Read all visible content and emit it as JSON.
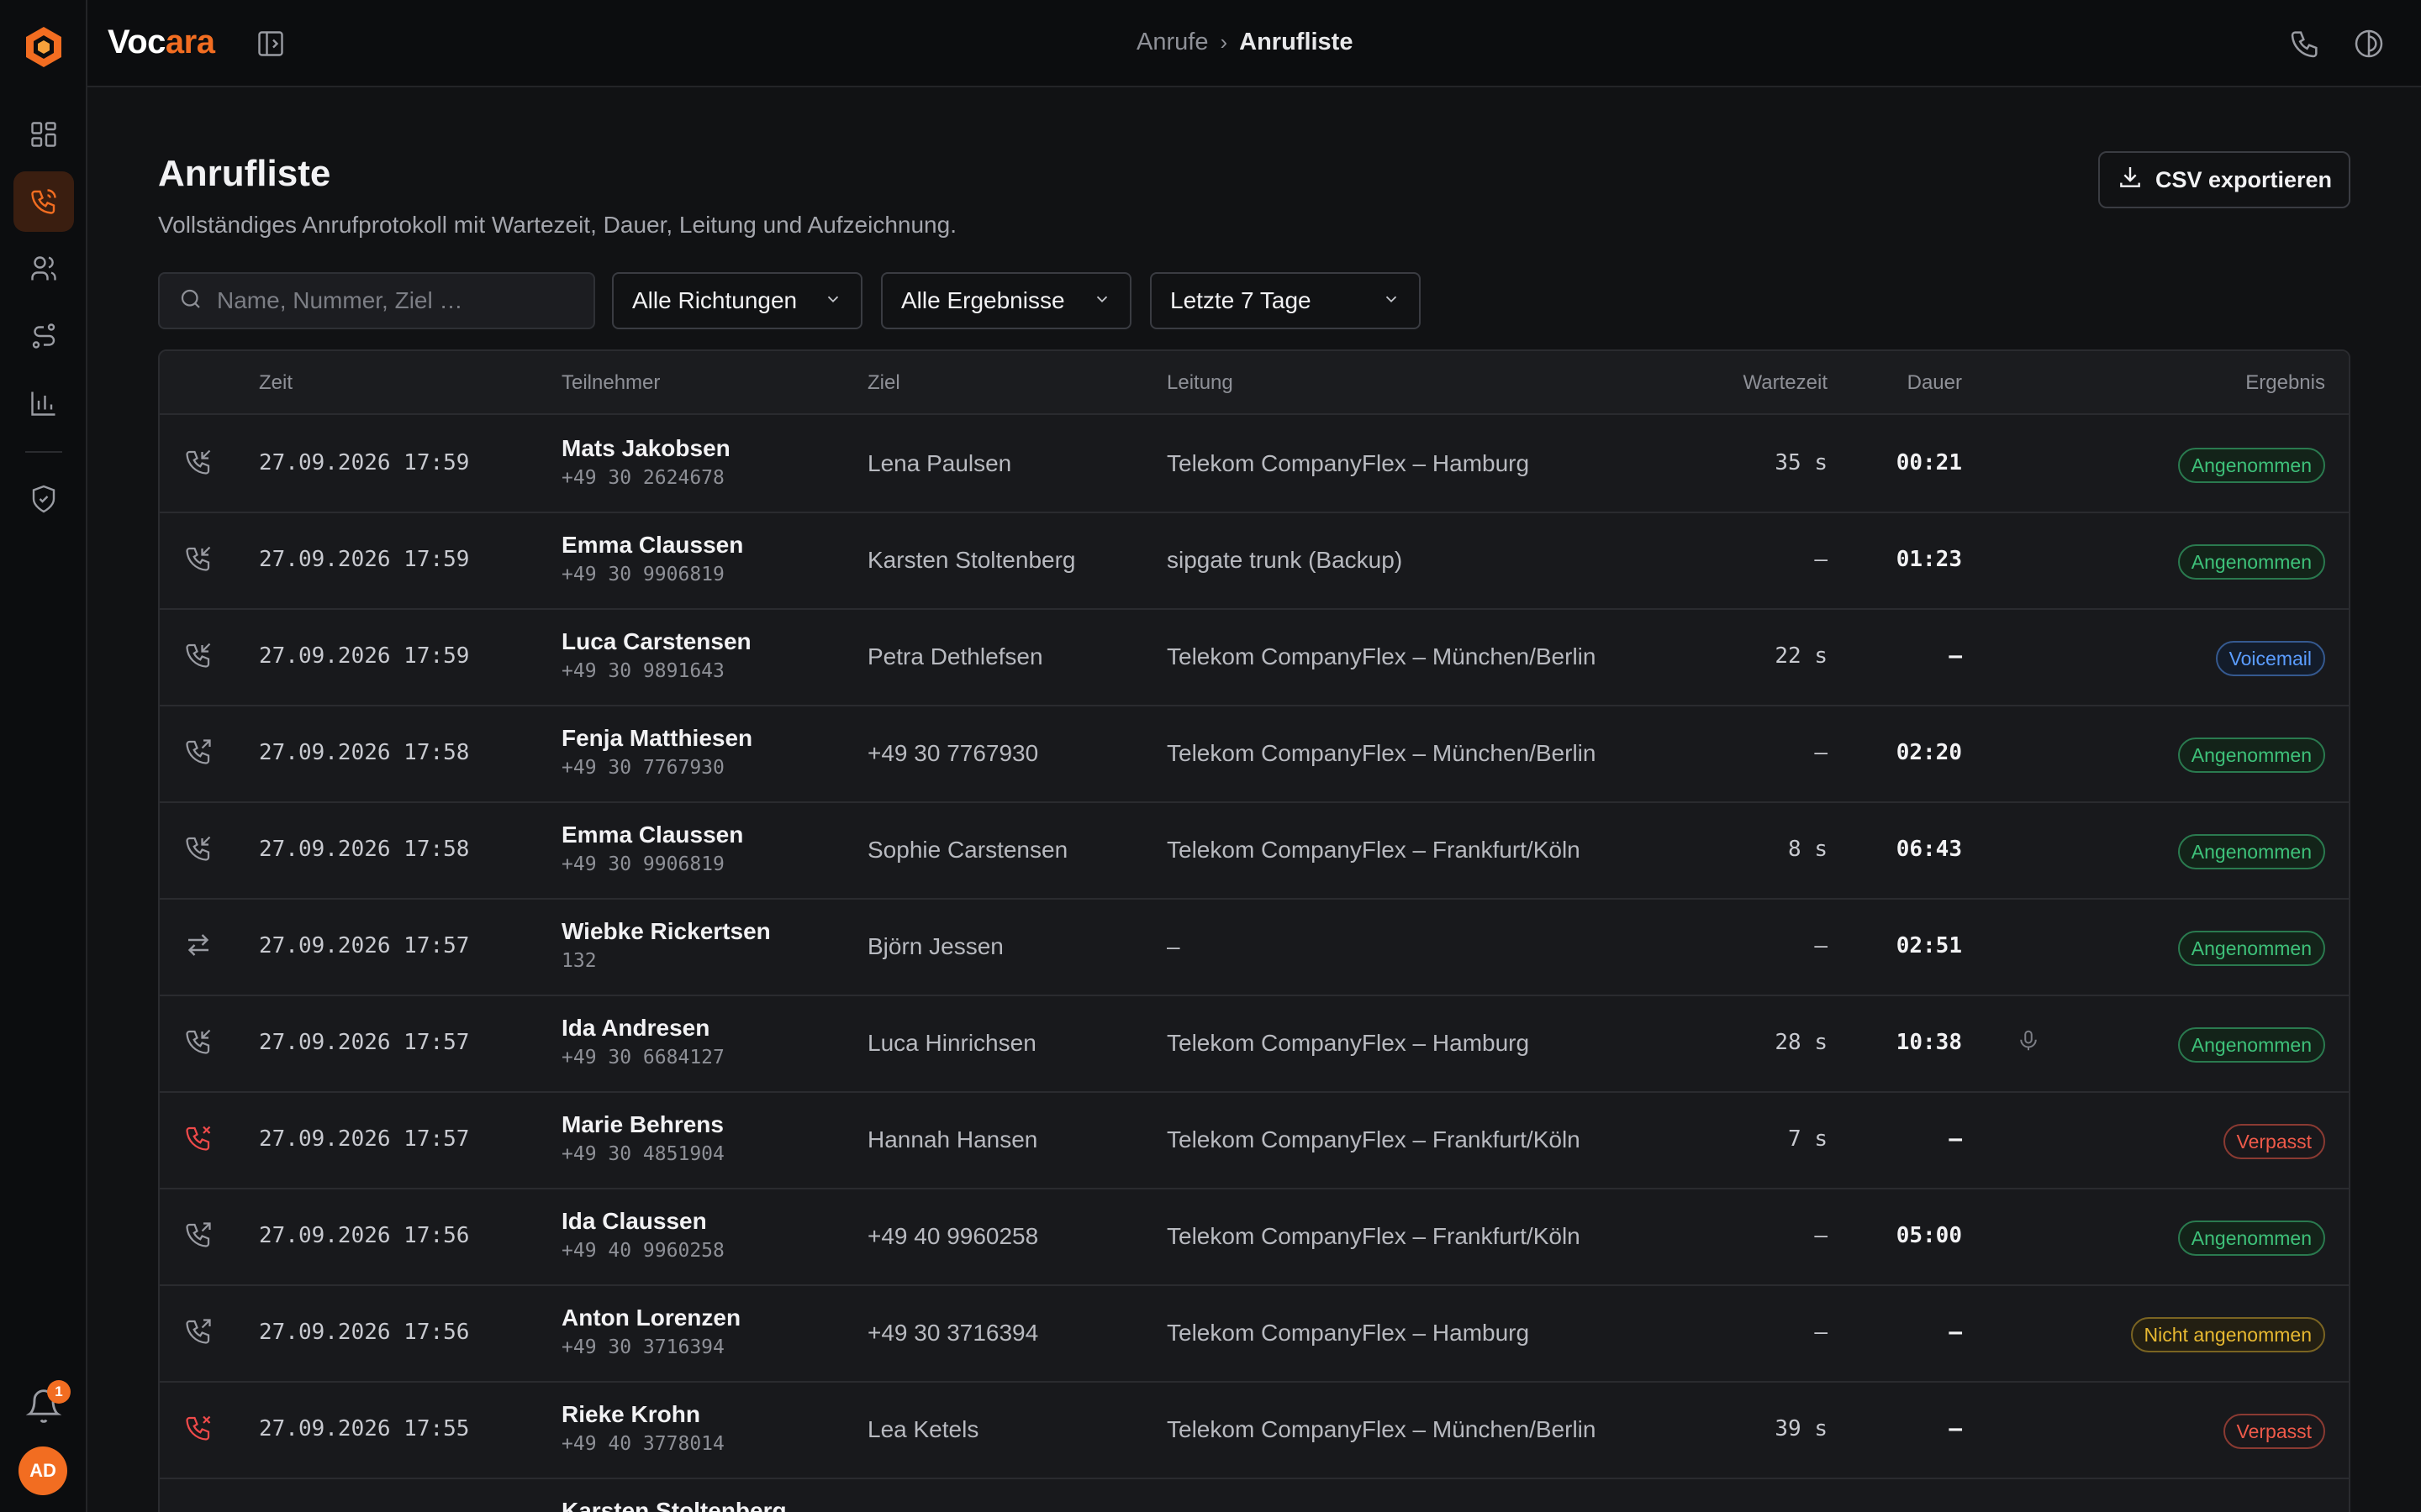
{
  "app": {
    "brand_main": "Voc",
    "brand_accent": "ara"
  },
  "breadcrumb": {
    "parent": "Anrufe",
    "current": "Anrufliste"
  },
  "page": {
    "title": "Anrufliste",
    "subtitle": "Vollständiges Anrufprotokoll mit Wartezeit, Dauer, Leitung und Aufzeichnung.",
    "export_label": "CSV exportieren"
  },
  "filters": {
    "search_placeholder": "Name, Nummer, Ziel …",
    "direction": "Alle Richtungen",
    "result": "Alle Ergebnisse",
    "period": "Letzte 7 Tage"
  },
  "table": {
    "headers": {
      "time": "Zeit",
      "participant": "Teilnehmer",
      "target": "Ziel",
      "line": "Leitung",
      "wait": "Wartezeit",
      "duration": "Dauer",
      "result": "Ergebnis"
    },
    "rows": [
      {
        "dir": "incoming",
        "time": "27.09.2026 17:59",
        "name": "Mats Jakobsen",
        "number": "+49 30 2624678",
        "target": "Lena Paulsen",
        "line": "Telekom CompanyFlex – Hamburg",
        "wait": "35 s",
        "duration": "00:21",
        "recording": false,
        "result": "Angenommen",
        "status": "ok"
      },
      {
        "dir": "incoming",
        "time": "27.09.2026 17:59",
        "name": "Emma Claussen",
        "number": "+49 30 9906819",
        "target": "Karsten Stoltenberg",
        "line": "sipgate trunk (Backup)",
        "wait": "–",
        "duration": "01:23",
        "recording": false,
        "result": "Angenommen",
        "status": "ok"
      },
      {
        "dir": "incoming",
        "time": "27.09.2026 17:59",
        "name": "Luca Carstensen",
        "number": "+49 30 9891643",
        "target": "Petra Dethlefsen",
        "line": "Telekom CompanyFlex – München/Berlin",
        "wait": "22 s",
        "duration": "–",
        "recording": false,
        "result": "Voicemail",
        "status": "vm"
      },
      {
        "dir": "outgoing",
        "time": "27.09.2026 17:58",
        "name": "Fenja Matthiesen",
        "number": "+49 30 7767930",
        "target": "+49 30 7767930",
        "line": "Telekom CompanyFlex – München/Berlin",
        "wait": "–",
        "duration": "02:20",
        "recording": false,
        "result": "Angenommen",
        "status": "ok"
      },
      {
        "dir": "incoming",
        "time": "27.09.2026 17:58",
        "name": "Emma Claussen",
        "number": "+49 30 9906819",
        "target": "Sophie Carstensen",
        "line": "Telekom CompanyFlex – Frankfurt/Köln",
        "wait": "8 s",
        "duration": "06:43",
        "recording": false,
        "result": "Angenommen",
        "status": "ok"
      },
      {
        "dir": "internal",
        "time": "27.09.2026 17:57",
        "name": "Wiebke Rickertsen",
        "number": "132",
        "target": "Björn Jessen",
        "line": "–",
        "wait": "–",
        "duration": "02:51",
        "recording": false,
        "result": "Angenommen",
        "status": "ok"
      },
      {
        "dir": "incoming",
        "time": "27.09.2026 17:57",
        "name": "Ida Andresen",
        "number": "+49 30 6684127",
        "target": "Luca Hinrichsen",
        "line": "Telekom CompanyFlex – Hamburg",
        "wait": "28 s",
        "duration": "10:38",
        "recording": true,
        "result": "Angenommen",
        "status": "ok"
      },
      {
        "dir": "missed",
        "time": "27.09.2026 17:57",
        "name": "Marie Behrens",
        "number": "+49 30 4851904",
        "target": "Hannah Hansen",
        "line": "Telekom CompanyFlex – Frankfurt/Köln",
        "wait": "7 s",
        "duration": "–",
        "recording": false,
        "result": "Verpasst",
        "status": "miss"
      },
      {
        "dir": "outgoing",
        "time": "27.09.2026 17:56",
        "name": "Ida Claussen",
        "number": "+49 40 9960258",
        "target": "+49 40 9960258",
        "line": "Telekom CompanyFlex – Frankfurt/Köln",
        "wait": "–",
        "duration": "05:00",
        "recording": false,
        "result": "Angenommen",
        "status": "ok"
      },
      {
        "dir": "outgoing",
        "time": "27.09.2026 17:56",
        "name": "Anton Lorenzen",
        "number": "+49 30 3716394",
        "target": "+49 30 3716394",
        "line": "Telekom CompanyFlex – Hamburg",
        "wait": "–",
        "duration": "–",
        "recording": false,
        "result": "Nicht angenommen",
        "status": "na"
      },
      {
        "dir": "missed",
        "time": "27.09.2026 17:55",
        "name": "Rieke Krohn",
        "number": "+49 40 3778014",
        "target": "Lea Ketels",
        "line": "Telekom CompanyFlex – München/Berlin",
        "wait": "39 s",
        "duration": "–",
        "recording": false,
        "result": "Verpasst",
        "status": "miss"
      },
      {
        "dir": "incoming",
        "time": "",
        "name": "Karsten Stoltenberg",
        "number": "",
        "target": "",
        "line": "",
        "wait": "",
        "duration": "",
        "recording": false,
        "result": "",
        "status": "ok"
      }
    ]
  },
  "notifications": {
    "count": "1"
  },
  "user": {
    "initials": "AD"
  },
  "colors": {
    "accent": "#f26d21",
    "success": "#3ec27a",
    "info": "#5b9dff",
    "danger": "#ef5a4a",
    "warning": "#e8b931"
  }
}
